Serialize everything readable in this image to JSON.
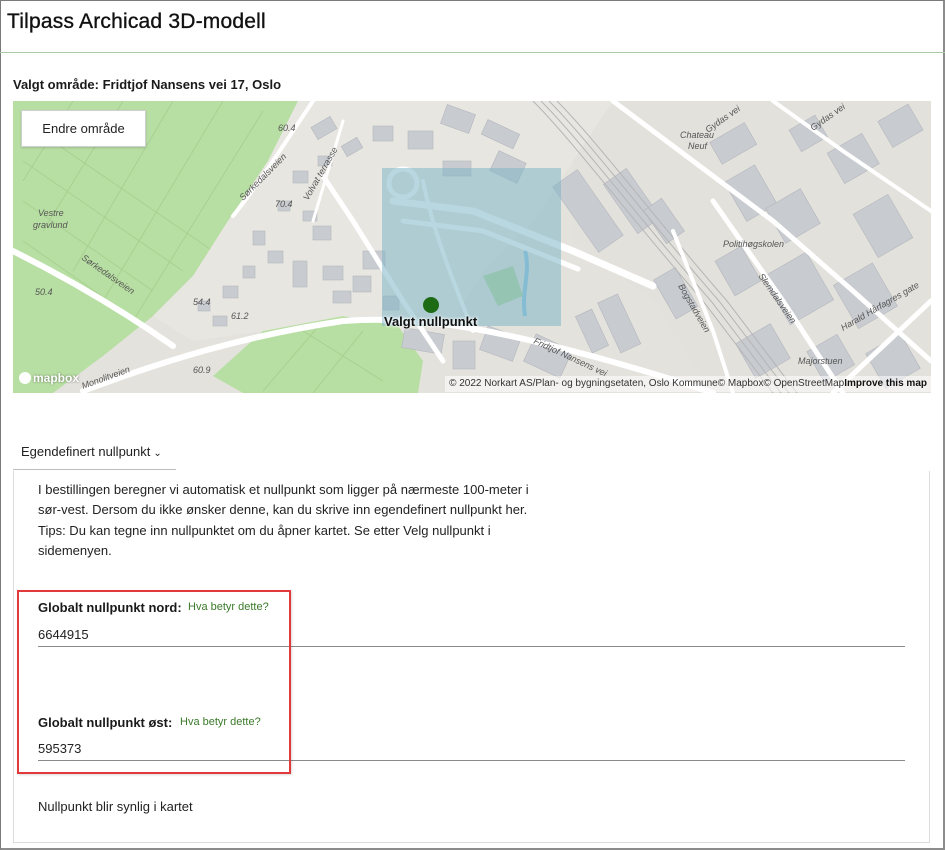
{
  "header": {
    "title": "Tilpass Archicad 3D-modell"
  },
  "selected_area": {
    "text": "Valgt område: Fridtjof Nansens vei 17, Oslo"
  },
  "map": {
    "change_area_button": "Endre område",
    "marker_label": "Valgt nullpunkt",
    "logo_text": "mapbox",
    "attribution": "© 2022 Norkart AS/Plan- og bygningsetaten, Oslo Kommune© Mapbox© OpenStreetMap",
    "improve_link": "Improve this map",
    "street_labels": [
      "Sørkedalsveien",
      "Volvat terrasse",
      "Sørkedalsveien",
      "Monolitveien",
      "Fridtjof Nansens vei",
      "Bogstadveien",
      "Slemdalsveien",
      "Harald Hårfagres gate",
      "Gydas vei",
      "Gydas vei",
      "Majorstuen",
      "Politihøgskolen",
      "Chateau Neuf",
      "Vestre gravlund"
    ],
    "elevation_labels": [
      "60.4",
      "70.4",
      "50.4",
      "54.4",
      "61.2",
      "60.9"
    ],
    "colors": {
      "park": "#b7dfa1",
      "road": "#ffffff",
      "building": "#c9ccd1",
      "selection": "#7fb6c6",
      "marker": "#1e6b16",
      "water": "#8ac4e3"
    }
  },
  "nullpoint_dropdown": {
    "label": "Egendefinert nullpunkt",
    "icon": "chevron-down-icon"
  },
  "info_text": {
    "line1": "I bestillingen beregner vi automatisk et nullpunkt som ligger på nærmeste 100-meter i",
    "line2": "sør-vest. Dersom du ikke ønsker denne, kan du skrive inn egendefinert nullpunkt her.",
    "line3": "Tips: Du kan tegne inn nullpunktet om du åpner kartet. Se etter Velg nullpunkt i",
    "line4": "sidemenyen."
  },
  "north_field": {
    "label": "Globalt nullpunkt nord:",
    "help": "Hva betyr dette?",
    "value": "6644915"
  },
  "east_field": {
    "label": "Globalt nullpunkt øst:",
    "help": "Hva betyr dette?",
    "value": "595373"
  },
  "footer_note": "Nullpunkt blir synlig i kartet"
}
